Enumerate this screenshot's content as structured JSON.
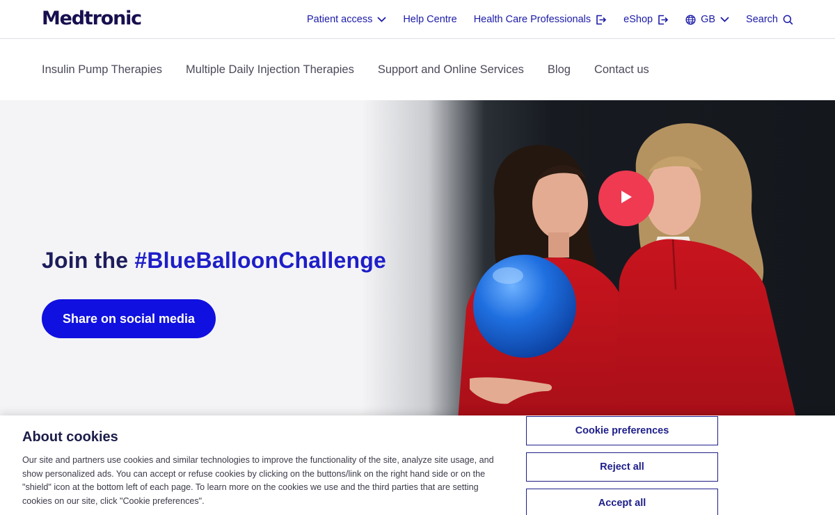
{
  "brand": {
    "logo_text": "Medtronic"
  },
  "utility_nav": {
    "patient_access": "Patient access",
    "help_centre": "Help Centre",
    "hcp": "Health Care Professionals",
    "eshop": "eShop",
    "region": "GB",
    "search": "Search"
  },
  "main_nav": {
    "items": [
      "Insulin Pump Therapies",
      "Multiple Daily Injection Therapies",
      "Support and Online Services",
      "Blog",
      "Contact us"
    ]
  },
  "hero": {
    "title_prefix": "Join the ",
    "title_hashtag": "#BlueBalloonChallenge",
    "cta_label": "Share on social media"
  },
  "cookie_banner": {
    "title": "About cookies",
    "text": "Our site and partners use cookies and similar technologies to improve the functionality of the site, analyze site usage, and show personalized ads. You can accept or refuse cookies by clicking on the buttons/link on the right hand side or on the \"shield\" icon at the bottom left of each page. To learn more on the cookies we use and the third parties that are setting cookies on our site, click \"Cookie preferences\".",
    "preferences_label": "Cookie preferences",
    "reject_label": "Reject all",
    "accept_label": "Accept all"
  },
  "colors": {
    "brand_navy": "#170f4f",
    "link_blue": "#1b1aa8",
    "cta_blue": "#1010e0",
    "play_red": "#ef3a52",
    "sweater_red": "#c8141e",
    "balloon_blue": "#1f6fe0"
  },
  "icons": [
    "chevron-down-icon",
    "external-link-icon",
    "globe-icon",
    "search-icon",
    "play-icon"
  ]
}
